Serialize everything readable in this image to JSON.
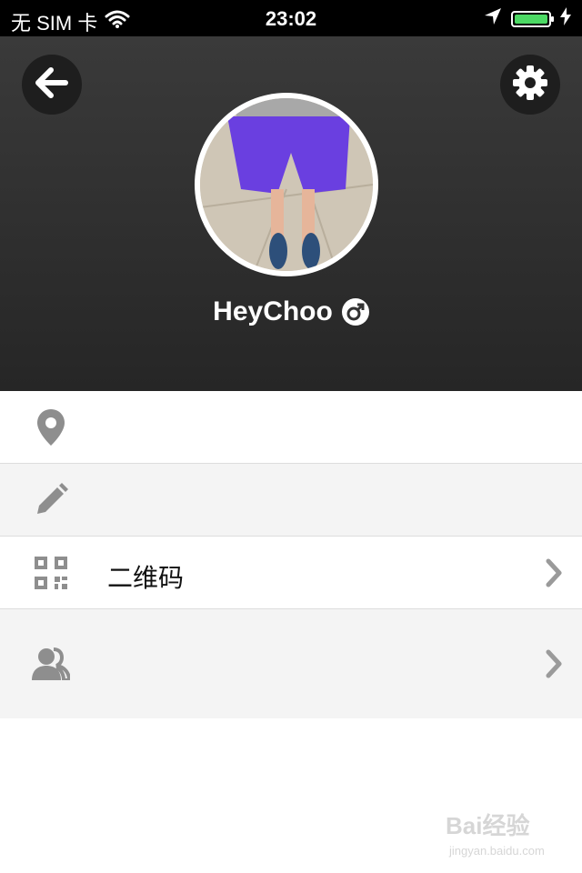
{
  "status_bar": {
    "carrier": "无 SIM 卡",
    "time": "23:02",
    "battery_level": 1.0,
    "icons": [
      "wifi-icon",
      "location-arrow-icon",
      "battery-icon",
      "charging-bolt-icon"
    ]
  },
  "header": {
    "back_icon": "arrow-left-icon",
    "settings_icon": "gear-icon",
    "profile_name": "HeyChoo",
    "gender_icon": "male-symbol-icon"
  },
  "menu": {
    "items": [
      {
        "icon": "location-pin-icon",
        "label": "",
        "has_chevron": false
      },
      {
        "icon": "pencil-icon",
        "label": "",
        "has_chevron": false
      },
      {
        "icon": "qr-code-icon",
        "label": "二维码",
        "has_chevron": true
      },
      {
        "icon": "contacts-icon",
        "label": "",
        "has_chevron": true
      }
    ]
  },
  "watermark": {
    "text": "Bai经验",
    "sub": "jingyan.baidu.com"
  },
  "colors": {
    "header_top": "#3a3a3a",
    "header_bottom": "#262626",
    "battery_green": "#4cd964",
    "icon_grey": "#8e8e8e",
    "row_alt": "#f4f4f4"
  }
}
